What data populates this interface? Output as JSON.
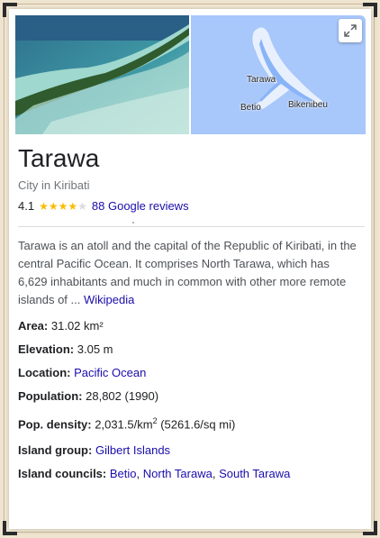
{
  "place": {
    "title": "Tarawa",
    "subtitle": "City in Kiribati",
    "rating": "4.1",
    "stars_filled": 4,
    "stars_total": 5,
    "reviews_link": "88 Google reviews"
  },
  "map": {
    "labels": {
      "tarawa": "Tarawa",
      "betio": "Betio",
      "bikenibeu": "Bikenibeu"
    },
    "expand_icon": "expand-icon"
  },
  "description": {
    "text": "Tarawa is an atoll and the capital of the Republic of Kiribati, in the central Pacific Ocean. It comprises North Tarawa, which has 6,629 inhabitants and much in common with other more remote islands of ...",
    "source_link": "Wikipedia"
  },
  "facts": {
    "area": {
      "label": "Area:",
      "value": "31.02 km²"
    },
    "elevation": {
      "label": "Elevation:",
      "value": "3.05 m"
    },
    "location": {
      "label": "Location:",
      "value": "Pacific Ocean"
    },
    "population": {
      "label": "Population:",
      "value": "28,802 (1990)"
    },
    "density": {
      "label": "Pop. density:",
      "value_main": "2,031.5/km",
      "value_sup": "2",
      "value_rest": "(5261.6/sq mi)"
    },
    "island_group": {
      "label": "Island group:",
      "value": "Gilbert Islands"
    },
    "councils": {
      "label": "Island councils:",
      "links": [
        "Betio",
        "North Tarawa",
        "South Tarawa"
      ]
    }
  },
  "colors": {
    "link": "#1a0dab",
    "star": "#fbbc04",
    "map_water": "#a8c7fa",
    "map_land": "#e8f0fe"
  }
}
